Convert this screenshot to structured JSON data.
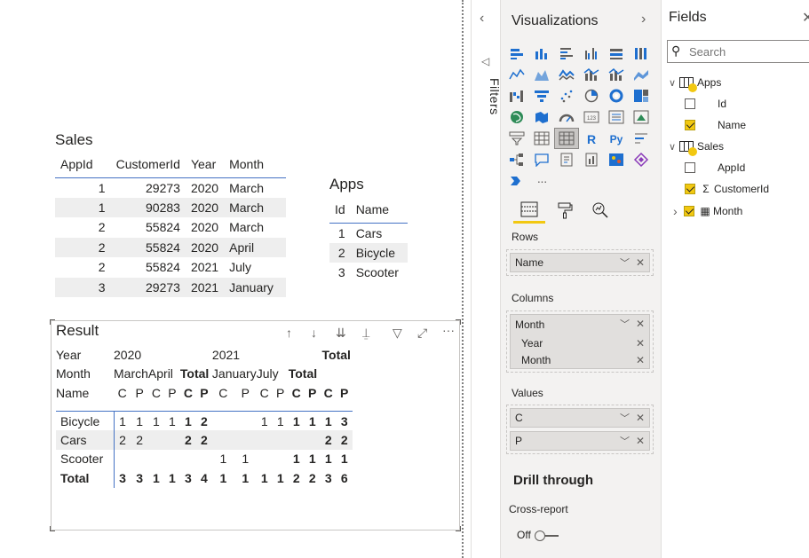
{
  "canvas": {
    "sales": {
      "title": "Sales",
      "columns": [
        "AppId",
        "CustomerId",
        "Year",
        "Month"
      ],
      "rows": [
        [
          "1",
          "29273",
          "2020",
          "March"
        ],
        [
          "1",
          "90283",
          "2020",
          "March"
        ],
        [
          "2",
          "55824",
          "2020",
          "March"
        ],
        [
          "2",
          "55824",
          "2020",
          "April"
        ],
        [
          "2",
          "55824",
          "2021",
          "July"
        ],
        [
          "3",
          "29273",
          "2021",
          "January"
        ]
      ]
    },
    "apps": {
      "title": "Apps",
      "columns": [
        "Id",
        "Name"
      ],
      "rows": [
        [
          "1",
          "Cars"
        ],
        [
          "2",
          "Bicycle"
        ],
        [
          "3",
          "Scooter"
        ]
      ]
    },
    "result": {
      "title": "Result",
      "row_label_year": "Year",
      "row_label_month": "Month",
      "row_label_name": "Name",
      "years": [
        {
          "label": "2020",
          "months": [
            "March",
            "April"
          ],
          "total_label": "Total"
        },
        {
          "label": "2021",
          "months": [
            "January",
            "July"
          ],
          "total_label": "Total"
        }
      ],
      "grand_total_label": "Total",
      "measures": [
        "C",
        "P"
      ],
      "rows": [
        {
          "name": "Bicycle",
          "cells": [
            "1",
            "1",
            "1",
            "1",
            "1",
            "2",
            "",
            "",
            "1",
            "1",
            "1",
            "1",
            "1",
            "3"
          ]
        },
        {
          "name": "Cars",
          "cells": [
            "2",
            "2",
            "",
            "",
            "2",
            "2",
            "",
            "",
            "",
            "",
            "",
            "",
            "2",
            "2"
          ]
        },
        {
          "name": "Scooter",
          "cells": [
            "",
            "",
            "",
            "",
            "",
            "",
            "1",
            "1",
            "",
            "",
            "1",
            "1",
            "1",
            "1"
          ]
        },
        {
          "name": "Total",
          "cells": [
            "3",
            "3",
            "1",
            "1",
            "3",
            "4",
            "1",
            "1",
            "1",
            "1",
            "2",
            "2",
            "3",
            "6"
          ]
        }
      ]
    }
  },
  "filters_pane": {
    "label": "Filters"
  },
  "visualizations": {
    "title": "Visualizations",
    "more_glyph": "···",
    "wells": {
      "rows_label": "Rows",
      "rows_field": "Name",
      "columns_label": "Columns",
      "columns_field": "Month",
      "columns_sub": [
        "Year",
        "Month"
      ],
      "values_label": "Values",
      "values_fields": [
        "C",
        "P"
      ]
    },
    "drill_through": "Drill through",
    "cross_report": "Cross-report",
    "cross_report_state": "Off"
  },
  "fields": {
    "title": "Fields",
    "search_placeholder": "Search",
    "tables": [
      {
        "name": "Apps",
        "fields": [
          {
            "name": "Id",
            "checked": false
          },
          {
            "name": "Name",
            "checked": true
          }
        ]
      },
      {
        "name": "Sales",
        "fields": [
          {
            "name": "AppId",
            "checked": false
          },
          {
            "name": "CustomerId",
            "checked": true
          },
          {
            "name": "Month",
            "checked": true
          }
        ]
      }
    ]
  },
  "colors": {
    "accent": "#f2c811",
    "table_rule": "#4472c4",
    "pane_bg": "#f3f2f1"
  }
}
